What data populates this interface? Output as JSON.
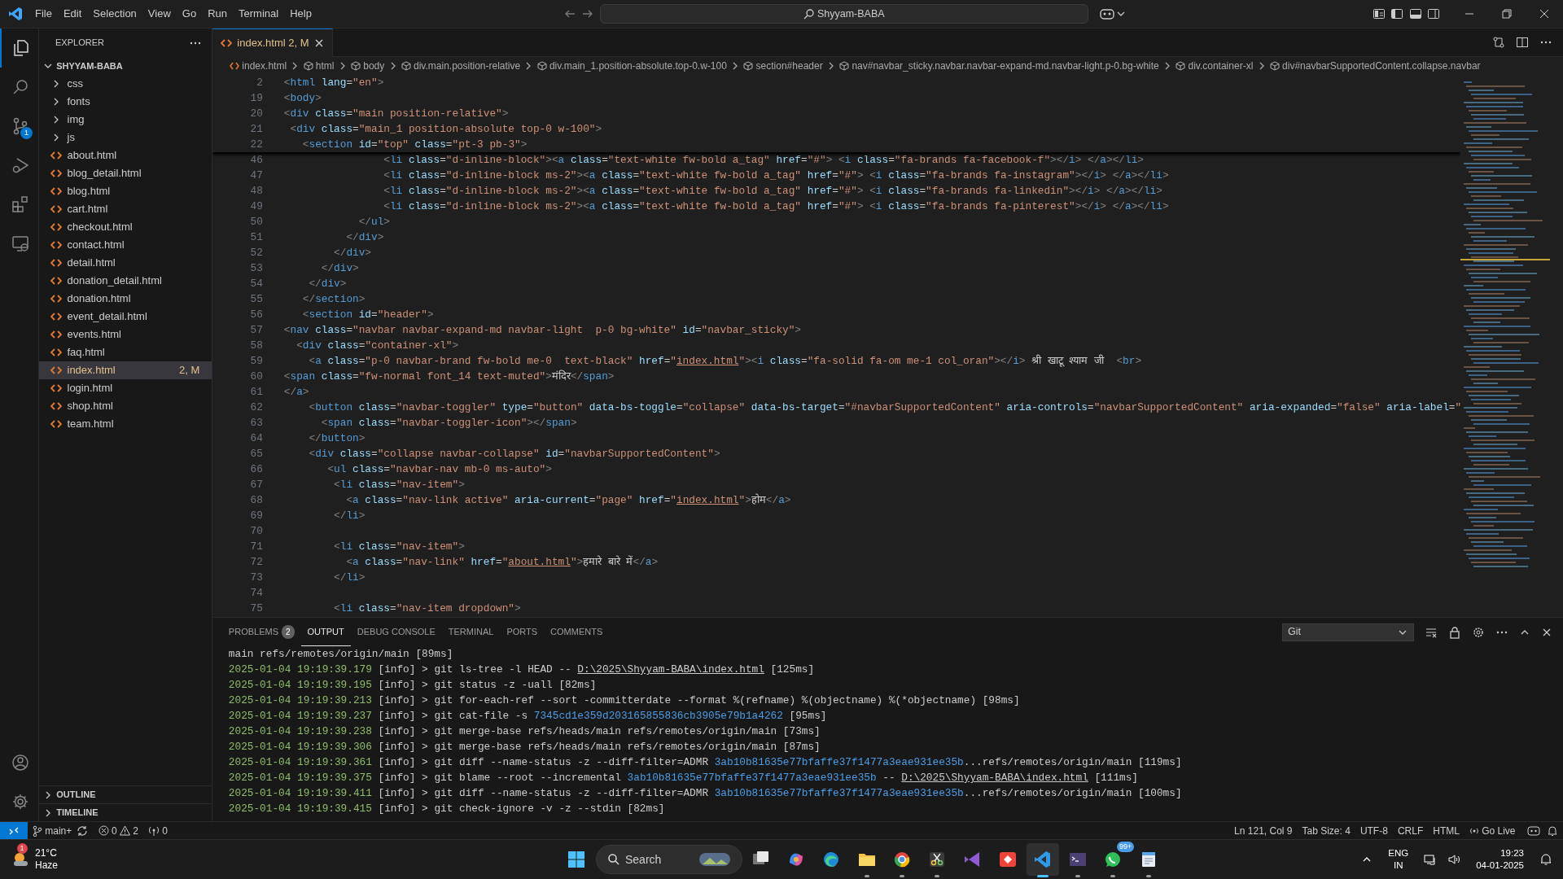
{
  "title_bar": {
    "menu": [
      "File",
      "Edit",
      "Selection",
      "View",
      "Go",
      "Run",
      "Terminal",
      "Help"
    ],
    "search": "Shyyam-BABA"
  },
  "activity_bar": {
    "items": [
      {
        "kind": "explorer",
        "selected": true
      },
      {
        "kind": "search",
        "selected": false
      },
      {
        "kind": "source_control",
        "selected": false,
        "badge": "1"
      },
      {
        "kind": "run_debug",
        "selected": false
      },
      {
        "kind": "extensions",
        "selected": false
      },
      {
        "kind": "remote",
        "selected": false
      }
    ],
    "bottom": [
      {
        "kind": "accounts"
      },
      {
        "kind": "manage"
      }
    ]
  },
  "sidebar": {
    "title": "EXPLORER",
    "folder": "SHYYAM-BABA",
    "items": [
      {
        "kind": "folder",
        "label": "css",
        "expanded": false
      },
      {
        "kind": "folder",
        "label": "fonts",
        "expanded": false
      },
      {
        "kind": "folder",
        "label": "img",
        "expanded": false
      },
      {
        "kind": "folder",
        "label": "js",
        "expanded": false
      },
      {
        "kind": "file",
        "label": "about.html",
        "selected": false,
        "modified": false
      },
      {
        "kind": "file",
        "label": "blog_detail.html",
        "selected": false,
        "modified": false
      },
      {
        "kind": "file",
        "label": "blog.html",
        "selected": false,
        "modified": false
      },
      {
        "kind": "file",
        "label": "cart.html",
        "selected": false,
        "modified": false
      },
      {
        "kind": "file",
        "label": "checkout.html",
        "selected": false,
        "modified": false
      },
      {
        "kind": "file",
        "label": "contact.html",
        "selected": false,
        "modified": false
      },
      {
        "kind": "file",
        "label": "detail.html",
        "selected": false,
        "modified": false
      },
      {
        "kind": "file",
        "label": "donation_detail.html",
        "selected": false,
        "modified": false
      },
      {
        "kind": "file",
        "label": "donation.html",
        "selected": false,
        "modified": false
      },
      {
        "kind": "file",
        "label": "event_detail.html",
        "selected": false,
        "modified": false
      },
      {
        "kind": "file",
        "label": "events.html",
        "selected": false,
        "modified": false
      },
      {
        "kind": "file",
        "label": "faq.html",
        "selected": false,
        "modified": false
      },
      {
        "kind": "file",
        "label": "index.html",
        "selected": true,
        "modified": true,
        "badge": "2, M"
      },
      {
        "kind": "file",
        "label": "login.html",
        "selected": false,
        "modified": false
      },
      {
        "kind": "file",
        "label": "shop.html",
        "selected": false,
        "modified": false
      },
      {
        "kind": "file",
        "label": "team.html",
        "selected": false,
        "modified": false
      }
    ],
    "sections": [
      {
        "label": "OUTLINE",
        "expanded": false
      },
      {
        "label": "TIMELINE",
        "expanded": false
      }
    ]
  },
  "editor": {
    "tab": {
      "label": "index.html",
      "badge": "2, M"
    },
    "breadcrumbs": [
      "index.html",
      "html",
      "body",
      "div.main.position-relative",
      "div.main_1.position-absolute.top-0.w-100",
      "section#header",
      "nav#navbar_sticky.navbar.navbar-expand-md.navbar-light.p-0.bg-white",
      "div.container-xl",
      "div#navbarSupportedContent.collapse.navbar"
    ],
    "sticky_lines": [
      {
        "number": "2",
        "parts": [
          "<html lang=\"en\">"
        ]
      },
      {
        "number": "19",
        "parts": [
          "<body>"
        ]
      },
      {
        "number": "20",
        "parts": [
          "<div class=\"main position-relative\">"
        ]
      },
      {
        "number": "21",
        "parts": [
          " <div class=\"main_1 position-absolute top-0 w-100\">"
        ]
      },
      {
        "number": "22",
        "parts": [
          "   <section id=\"top\" class=\"pt-3 pb-3\">"
        ]
      }
    ],
    "lines": [
      {
        "number": "46",
        "parts": [
          "                <li class=\"d-inline-block\"><a class=\"text-white fw-bold a_tag\" href=\"#\"> <i class=\"fa-brands fa-facebook-f\"></i> </a></li>"
        ]
      },
      {
        "number": "47",
        "parts": [
          "                <li class=\"d-inline-block ms-2\"><a class=\"text-white fw-bold a_tag\" href=\"#\"> <i class=\"fa-brands fa-instagram\"></i> </a></li>"
        ]
      },
      {
        "number": "48",
        "parts": [
          "                <li class=\"d-inline-block ms-2\"><a class=\"text-white fw-bold a_tag\" href=\"#\"> <i class=\"fa-brands fa-linkedin\"></i> </a></li>"
        ]
      },
      {
        "number": "49",
        "parts": [
          "                <li class=\"d-inline-block ms-2\"><a class=\"text-white fw-bold a_tag\" href=\"#\"> <i class=\"fa-brands fa-pinterest\"></i> </a></li>"
        ]
      },
      {
        "number": "50",
        "parts": [
          "            </ul>"
        ]
      },
      {
        "number": "51",
        "parts": [
          "          </div>"
        ]
      },
      {
        "number": "52",
        "parts": [
          "        </div>"
        ]
      },
      {
        "number": "53",
        "parts": [
          "      </div>"
        ]
      },
      {
        "number": "54",
        "parts": [
          "    </div>"
        ]
      },
      {
        "number": "55",
        "parts": [
          "   </section>"
        ]
      },
      {
        "number": "56",
        "parts": [
          "   <section id=\"header\">"
        ]
      },
      {
        "number": "57",
        "parts": [
          "<nav class=\"navbar navbar-expand-md navbar-light  p-0 bg-white\" id=\"navbar_sticky\">"
        ]
      },
      {
        "number": "58",
        "parts": [
          "  <div class=\"container-xl\">"
        ]
      },
      {
        "number": "59",
        "parts": [
          "    <a class=\"p-0 navbar-brand fw-bold me-0  text-black\" href=\"",
          "index.html",
          "\"><i class=\"fa-solid fa-om me-1 col_oran\"></i> श्री खाटू श्याम जी  <br>"
        ]
      },
      {
        "number": "60",
        "parts": [
          "<span class=\"fw-normal font_14 text-muted\">मंदिर</span>"
        ]
      },
      {
        "number": "61",
        "parts": [
          "</a>"
        ]
      },
      {
        "number": "62",
        "parts": [
          "    <button class=\"navbar-toggler\" type=\"button\" data-bs-toggle=\"collapse\" data-bs-target=\"#navbarSupportedContent\" aria-controls=\"navbarSupportedContent\" aria-expanded=\"false\" aria-label=\""
        ]
      },
      {
        "number": "63",
        "parts": [
          "      <span class=\"navbar-toggler-icon\"></span>"
        ]
      },
      {
        "number": "64",
        "parts": [
          "    </button>"
        ]
      },
      {
        "number": "65",
        "parts": [
          "    <div class=\"collapse navbar-collapse\" id=\"navbarSupportedContent\">"
        ]
      },
      {
        "number": "66",
        "parts": [
          "       <ul class=\"navbar-nav mb-0 ms-auto\">"
        ]
      },
      {
        "number": "67",
        "parts": [
          "        <li class=\"nav-item\">"
        ]
      },
      {
        "number": "68",
        "parts": [
          "          <a class=\"nav-link active\" aria-current=\"page\" href=\"",
          "index.html",
          "\">होम</a>"
        ]
      },
      {
        "number": "69",
        "parts": [
          "        </li>"
        ]
      },
      {
        "number": "70"
      },
      {
        "number": "71",
        "parts": [
          "        <li class=\"nav-item\">"
        ]
      },
      {
        "number": "72",
        "parts": [
          "          <a class=\"nav-link\" href=\"",
          "about.html",
          "\">हमारे बारे में</a>"
        ]
      },
      {
        "number": "73",
        "parts": [
          "        </li>"
        ]
      },
      {
        "number": "74"
      },
      {
        "number": "75",
        "parts": [
          "        <li class=\"nav-item dropdown\">"
        ]
      }
    ]
  },
  "panel": {
    "tabs": [
      {
        "label": "PROBLEMS",
        "badge": "2",
        "selected": false
      },
      {
        "label": "OUTPUT",
        "selected": true
      },
      {
        "label": "DEBUG CONSOLE",
        "selected": false
      },
      {
        "label": "TERMINAL",
        "selected": false
      },
      {
        "label": "PORTS",
        "selected": false
      },
      {
        "label": "COMMENTS",
        "selected": false
      }
    ],
    "channel": "Git",
    "log": [
      {
        "parts": [
          {
            "kind": "text",
            "text": "main refs/remotes/origin/main [89ms]"
          }
        ]
      },
      {
        "time": "2025-01-04 19:19:39.179",
        "level": "[info]",
        "parts": [
          {
            "kind": "text",
            "text": "> git ls-tree -l HEAD -- "
          },
          {
            "kind": "link",
            "text": "D:\\2025\\Shyyam-BABA\\index.html"
          },
          {
            "kind": "text",
            "text": " [125ms]"
          }
        ]
      },
      {
        "time": "2025-01-04 19:19:39.195",
        "level": "[info]",
        "parts": [
          {
            "kind": "text",
            "text": "> git status -z -uall [82ms]"
          }
        ]
      },
      {
        "time": "2025-01-04 19:19:39.213",
        "level": "[info]",
        "parts": [
          {
            "kind": "text",
            "text": "> git for-each-ref --sort -committerdate --format %(refname) %(objectname) %(*objectname) [98ms]"
          }
        ]
      },
      {
        "time": "2025-01-04 19:19:39.237",
        "level": "[info]",
        "parts": [
          {
            "kind": "text",
            "text": "> git cat-file -s "
          },
          {
            "kind": "hash",
            "text": "7345cd1e359d203165855836cb3905e79b1a4262"
          },
          {
            "kind": "text",
            "text": " [95ms]"
          }
        ]
      },
      {
        "time": "2025-01-04 19:19:39.238",
        "level": "[info]",
        "parts": [
          {
            "kind": "text",
            "text": "> git merge-base refs/heads/main refs/remotes/origin/main [73ms]"
          }
        ]
      },
      {
        "time": "2025-01-04 19:19:39.306",
        "level": "[info]",
        "parts": [
          {
            "kind": "text",
            "text": "> git merge-base refs/heads/main refs/remotes/origin/main [87ms]"
          }
        ]
      },
      {
        "time": "2025-01-04 19:19:39.361",
        "level": "[info]",
        "parts": [
          {
            "kind": "text",
            "text": "> git diff --name-status -z --diff-filter=ADMR "
          },
          {
            "kind": "hash",
            "text": "3ab10b81635e77bfaffe37f1477a3eae931ee35b"
          },
          {
            "kind": "text",
            "text": "...refs/remotes/origin/main [119ms]"
          }
        ]
      },
      {
        "time": "2025-01-04 19:19:39.375",
        "level": "[info]",
        "parts": [
          {
            "kind": "text",
            "text": "> git blame --root --incremental "
          },
          {
            "kind": "hash",
            "text": "3ab10b81635e77bfaffe37f1477a3eae931ee35b"
          },
          {
            "kind": "text",
            "text": " -- "
          },
          {
            "kind": "link",
            "text": "D:\\2025\\Shyyam-BABA\\index.html"
          },
          {
            "kind": "text",
            "text": " [111ms]"
          }
        ]
      },
      {
        "time": "2025-01-04 19:19:39.411",
        "level": "[info]",
        "parts": [
          {
            "kind": "text",
            "text": "> git diff --name-status -z --diff-filter=ADMR "
          },
          {
            "kind": "hash",
            "text": "3ab10b81635e77bfaffe37f1477a3eae931ee35b"
          },
          {
            "kind": "text",
            "text": "...refs/remotes/origin/main [100ms]"
          }
        ]
      },
      {
        "time": "2025-01-04 19:19:39.415",
        "level": "[info]",
        "parts": [
          {
            "kind": "text",
            "text": "> git check-ignore -v -z --stdin [82ms]"
          }
        ]
      }
    ]
  },
  "status_bar": {
    "branch": "main+",
    "errors": "0",
    "warnings": "2",
    "ports": "0",
    "right": [
      "Ln 121, Col 9",
      "Tab Size: 4",
      "UTF-8",
      "CRLF",
      "HTML"
    ],
    "go_live": "Go Live"
  },
  "taskbar": {
    "weather": {
      "temp": "21°C",
      "condition": "Haze",
      "badge": "1"
    },
    "search": "Search",
    "apps": [
      {
        "kind": "task_view",
        "running": false,
        "selected": false
      },
      {
        "kind": "copilot",
        "running": false,
        "selected": false
      },
      {
        "kind": "edge",
        "running": false,
        "selected": false
      },
      {
        "kind": "files",
        "running": true,
        "selected": false
      },
      {
        "kind": "chrome",
        "running": true,
        "selected": false
      },
      {
        "kind": "snip",
        "running": true,
        "selected": false
      },
      {
        "kind": "studio",
        "running": false,
        "selected": false
      },
      {
        "kind": "remote_desk",
        "running": false,
        "selected": false
      },
      {
        "kind": "vscode",
        "running": true,
        "selected": true
      },
      {
        "kind": "terminal",
        "running": true,
        "selected": false
      },
      {
        "kind": "chat",
        "running": true,
        "selected": false,
        "badge": "99+"
      },
      {
        "kind": "notepad",
        "running": true,
        "selected": false
      }
    ],
    "language": {
      "lang": "ENG",
      "region": "IN"
    },
    "clock": {
      "time": "19:23",
      "date": "04-01-2025"
    }
  }
}
